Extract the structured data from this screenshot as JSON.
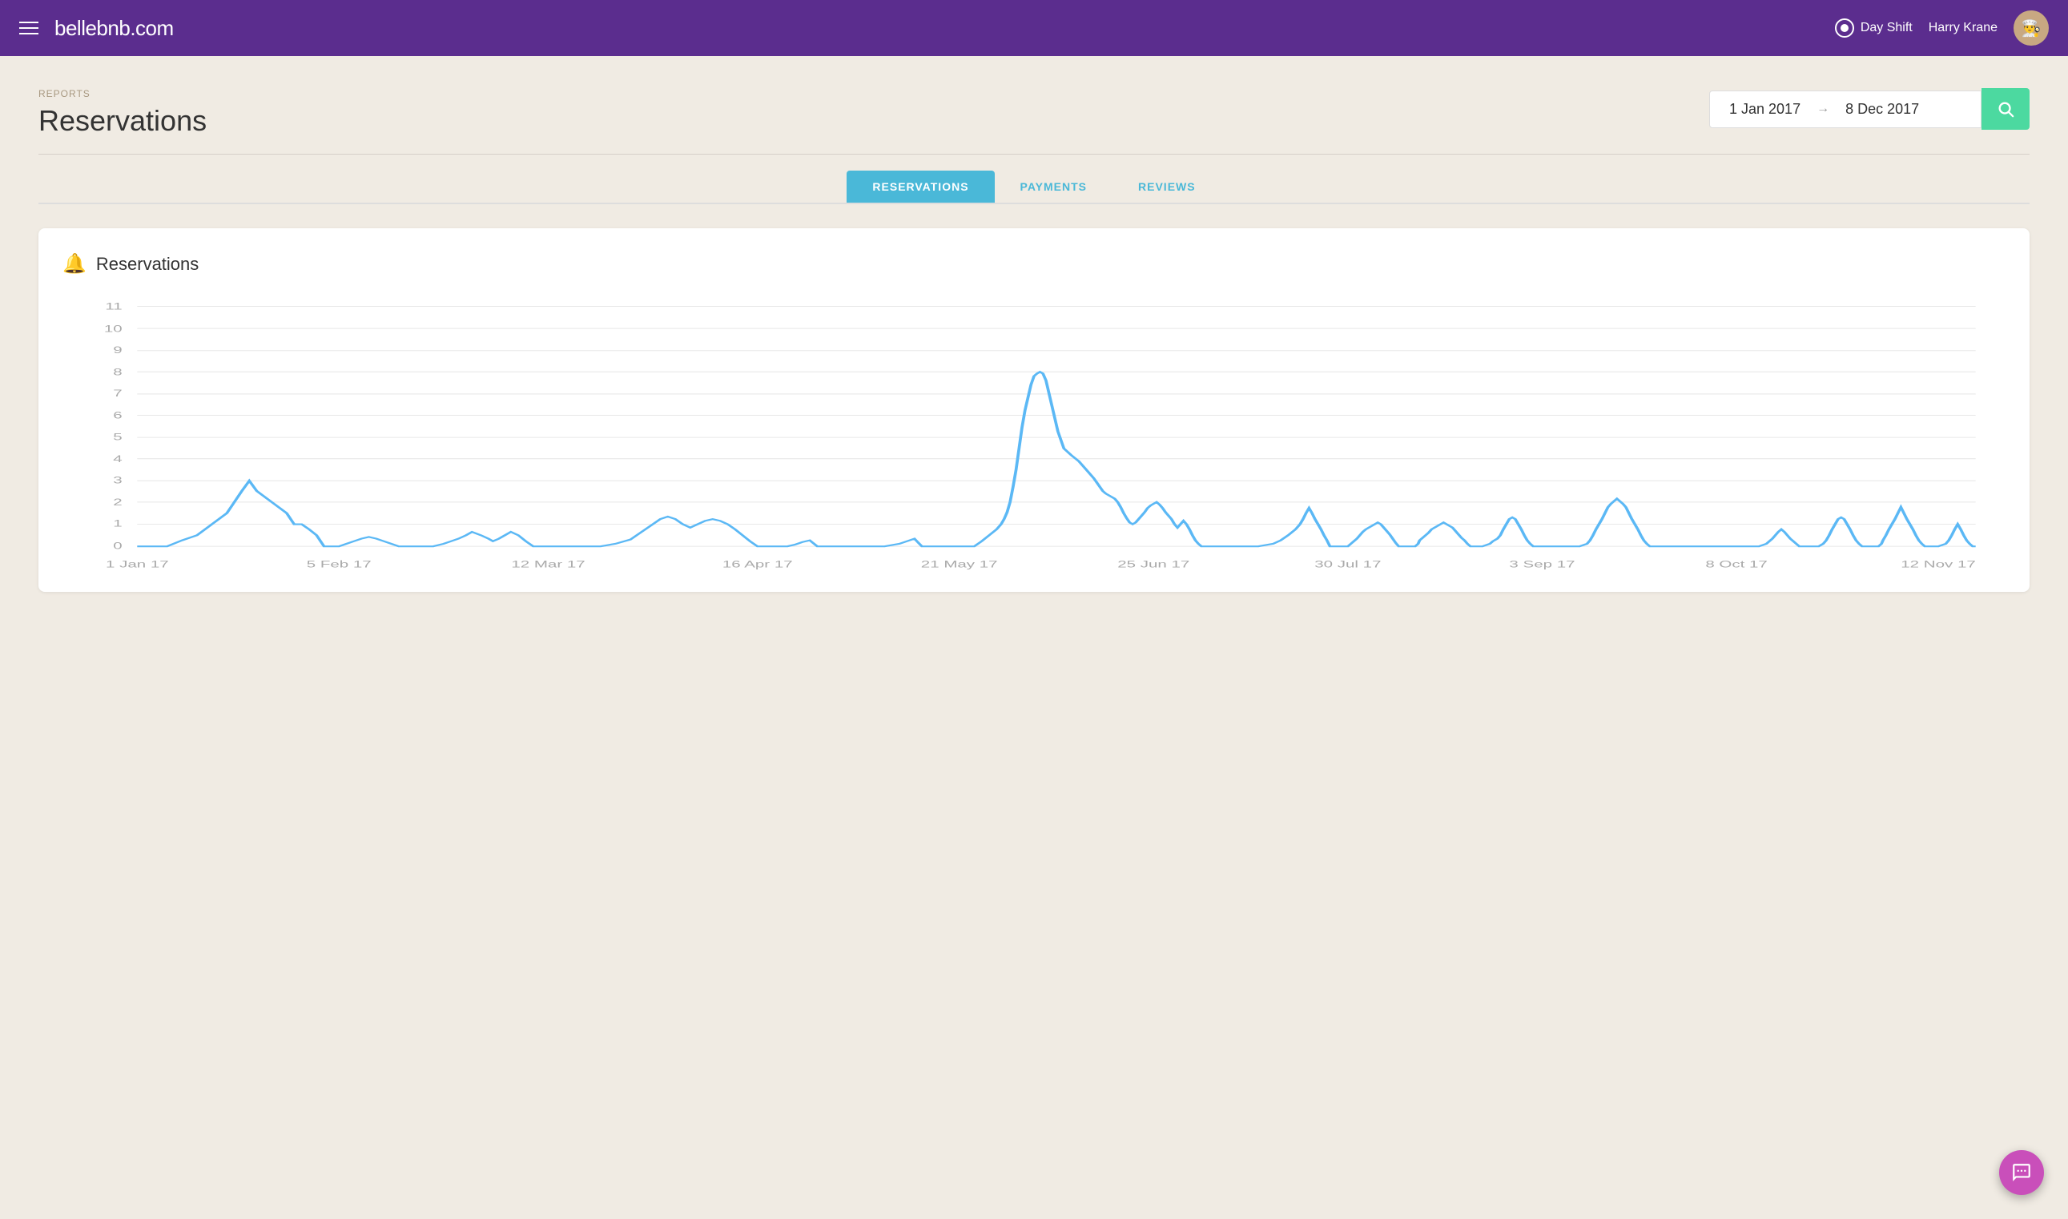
{
  "header": {
    "logo": "bellebnb.com",
    "day_shift_label": "Day Shift",
    "user_name": "Harry Krane",
    "avatar_emoji": "👨‍🍳"
  },
  "breadcrumb": "REPORTS",
  "page_title": "Reservations",
  "date_range": {
    "start": "1 Jan 2017",
    "end": "8 Dec 2017",
    "arrow": "→"
  },
  "tabs": [
    {
      "label": "RESERVATIONS",
      "active": true
    },
    {
      "label": "PAYMENTS",
      "active": false
    },
    {
      "label": "REVIEWS",
      "active": false
    }
  ],
  "chart": {
    "title": "Reservations",
    "y_labels": [
      "0",
      "1",
      "2",
      "3",
      "4",
      "5",
      "6",
      "7",
      "8",
      "9",
      "10",
      "11"
    ],
    "x_labels": [
      "1 Jan 17",
      "5 Feb 17",
      "12 Mar 17",
      "16 Apr 17",
      "21 May 17",
      "25 Jun 17",
      "30 Jul 17",
      "3 Sep 17",
      "8 Oct 17",
      "12 Nov 17"
    ]
  },
  "search_button_label": "Search",
  "chat_button_label": "Chat"
}
